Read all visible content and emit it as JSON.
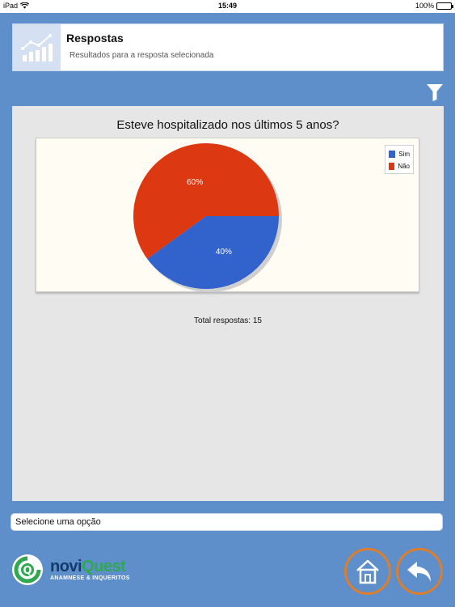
{
  "status": {
    "device": "iPad",
    "time": "15:49",
    "battery": "100%"
  },
  "header": {
    "title": "Respostas",
    "subtitle": "Resultados para a resposta selecionada"
  },
  "chart_data": {
    "type": "pie",
    "title": "Esteve hospitalizado nos últimos 5 anos?",
    "categories": [
      "Sim",
      "Não"
    ],
    "values": [
      40,
      60
    ],
    "labels": [
      "40%",
      "60%"
    ],
    "colors": [
      "#3262cc",
      "#dc3912"
    ],
    "legend": "top-right"
  },
  "summary": {
    "total": "Total respostas: 15"
  },
  "select": {
    "placeholder": "Selecione uma opção"
  },
  "logo": {
    "brand_a": "novi",
    "brand_b": "Quest",
    "tagline": "ANAMNESE & INQUERITOS"
  },
  "colors": {
    "background": "#5f8fca",
    "accent": "#de7d2b",
    "brand_green": "#2fa84f"
  }
}
